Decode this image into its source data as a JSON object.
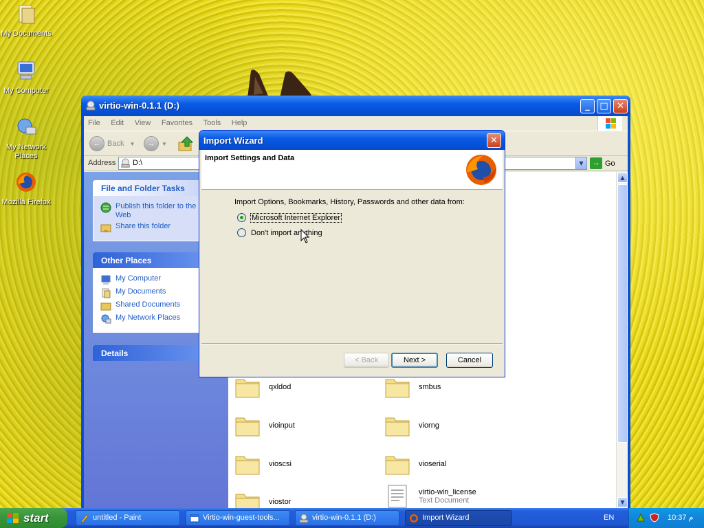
{
  "desktop": {
    "icons": [
      {
        "label": "My Documents"
      },
      {
        "label": "My Computer"
      },
      {
        "label": "My Network Places"
      },
      {
        "label": "Mozilla Firefox"
      }
    ]
  },
  "explorer": {
    "title": "virtio-win-0.1.1 (D:)",
    "menu": [
      "File",
      "Edit",
      "View",
      "Favorites",
      "Tools",
      "Help"
    ],
    "toolbar": {
      "back_label": "Back"
    },
    "address": {
      "label": "Address",
      "value": "D:\\",
      "go_label": "Go"
    },
    "file_tasks": {
      "header": "File and Folder Tasks",
      "items": [
        "Publish this folder to the Web",
        "Share this folder"
      ]
    },
    "other_places": {
      "header": "Other Places",
      "items": [
        "My Computer",
        "My Documents",
        "Shared Documents",
        "My Network Places"
      ]
    },
    "details": {
      "header": "Details"
    },
    "files": [
      {
        "name": "qxldod"
      },
      {
        "name": "smbus"
      },
      {
        "name": "vioinput"
      },
      {
        "name": "viorng"
      },
      {
        "name": "vioscsi"
      },
      {
        "name": "vioserial"
      },
      {
        "name": "viostor"
      },
      {
        "name": "virtio-win_license",
        "subtitle": "Text Document"
      }
    ]
  },
  "wizard": {
    "title": "Import Wizard",
    "heading": "Import Settings and Data",
    "prompt": "Import Options, Bookmarks, History, Passwords and other data from:",
    "options": [
      {
        "label": "Microsoft Internet Explorer",
        "checked": true
      },
      {
        "label": "Don't import anything",
        "checked": false
      }
    ],
    "buttons": {
      "back": "< Back",
      "next": "Next >",
      "cancel": "Cancel"
    }
  },
  "taskbar": {
    "start_label": "start",
    "tasks": [
      {
        "label": "untitled - Paint"
      },
      {
        "label": "Virtio-win-guest-tools..."
      },
      {
        "label": "virtio-win-0.1.1 (D:)"
      },
      {
        "label": "Import Wizard"
      }
    ],
    "language": "EN",
    "clock": "10:37 م"
  },
  "colors": {
    "xp_blue": "#0a4fd8",
    "start_green": "#3c963c",
    "link_blue": "#215dc6"
  }
}
